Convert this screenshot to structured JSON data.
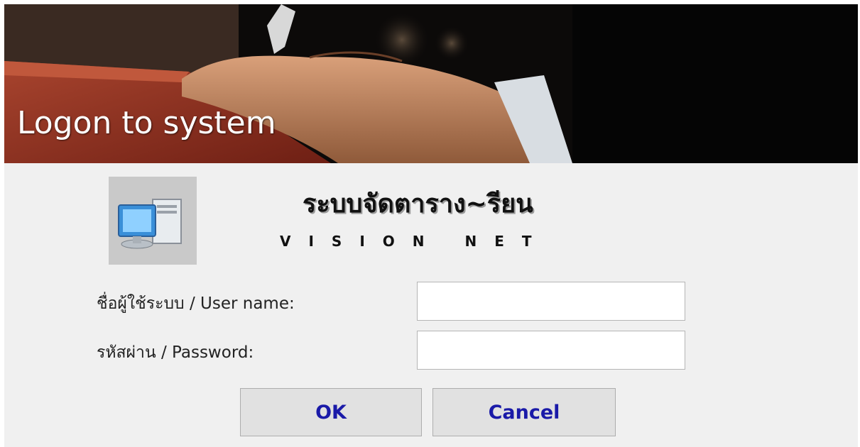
{
  "banner": {
    "title": "Logon to system"
  },
  "app": {
    "icon": "computer-icon",
    "title": "ระบบจัดตาราง~รียน",
    "subtitle": "VISION NET"
  },
  "form": {
    "username_label": "ชื่อผู้ใช้ระบบ / User name:",
    "username_value": "",
    "password_label": "รหัสผ่าน / Password:",
    "password_value": ""
  },
  "buttons": {
    "ok_label": "OK",
    "cancel_label": "Cancel"
  },
  "colors": {
    "button_text": "#1a1aa8",
    "dialog_background": "#f0f0f0"
  }
}
